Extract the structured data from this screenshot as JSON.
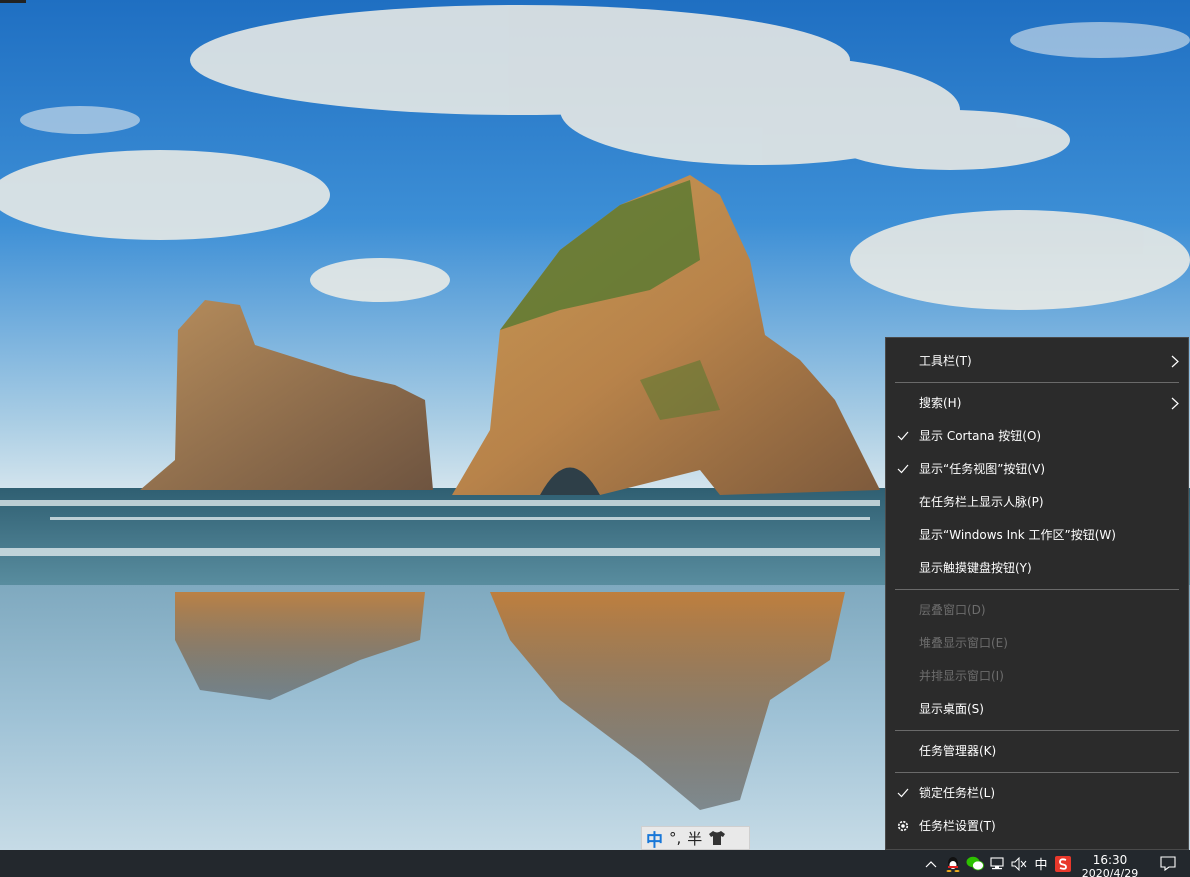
{
  "context_menu": {
    "items": [
      {
        "label": "工具栏(T)"
      },
      {
        "label": "搜索(H)"
      },
      {
        "label": "显示 Cortana 按钮(O)"
      },
      {
        "label": "显示“任务视图”按钮(V)"
      },
      {
        "label": "在任务栏上显示人脉(P)"
      },
      {
        "label": "显示“Windows Ink 工作区”按钮(W)"
      },
      {
        "label": "显示触摸键盘按钮(Y)"
      },
      {
        "label": "层叠窗口(D)"
      },
      {
        "label": "堆叠显示窗口(E)"
      },
      {
        "label": "并排显示窗口(I)"
      },
      {
        "label": "显示桌面(S)"
      },
      {
        "label": "任务管理器(K)"
      },
      {
        "label": "锁定任务栏(L)"
      },
      {
        "label": "任务栏设置(T)"
      }
    ]
  },
  "ime_bar": {
    "lang": "中",
    "punct": "°,",
    "width_mode": "半",
    "skin_icon": "shirt-icon"
  },
  "taskbar": {
    "tray_ime": "中",
    "clock_time": "16:30",
    "clock_date": "2020/4/29",
    "tray_icons": [
      "chevron-up-icon",
      "qq-icon",
      "wechat-icon",
      "network-icon",
      "volume-muted-icon",
      "sogou-icon",
      "notification-icon"
    ]
  },
  "colors": {
    "menu_bg": "#2b2b2b",
    "menu_text": "#ffffff",
    "menu_disabled": "#6d6d6d",
    "taskbar_bg": "#23282d",
    "ime_accent": "#1877d8"
  }
}
